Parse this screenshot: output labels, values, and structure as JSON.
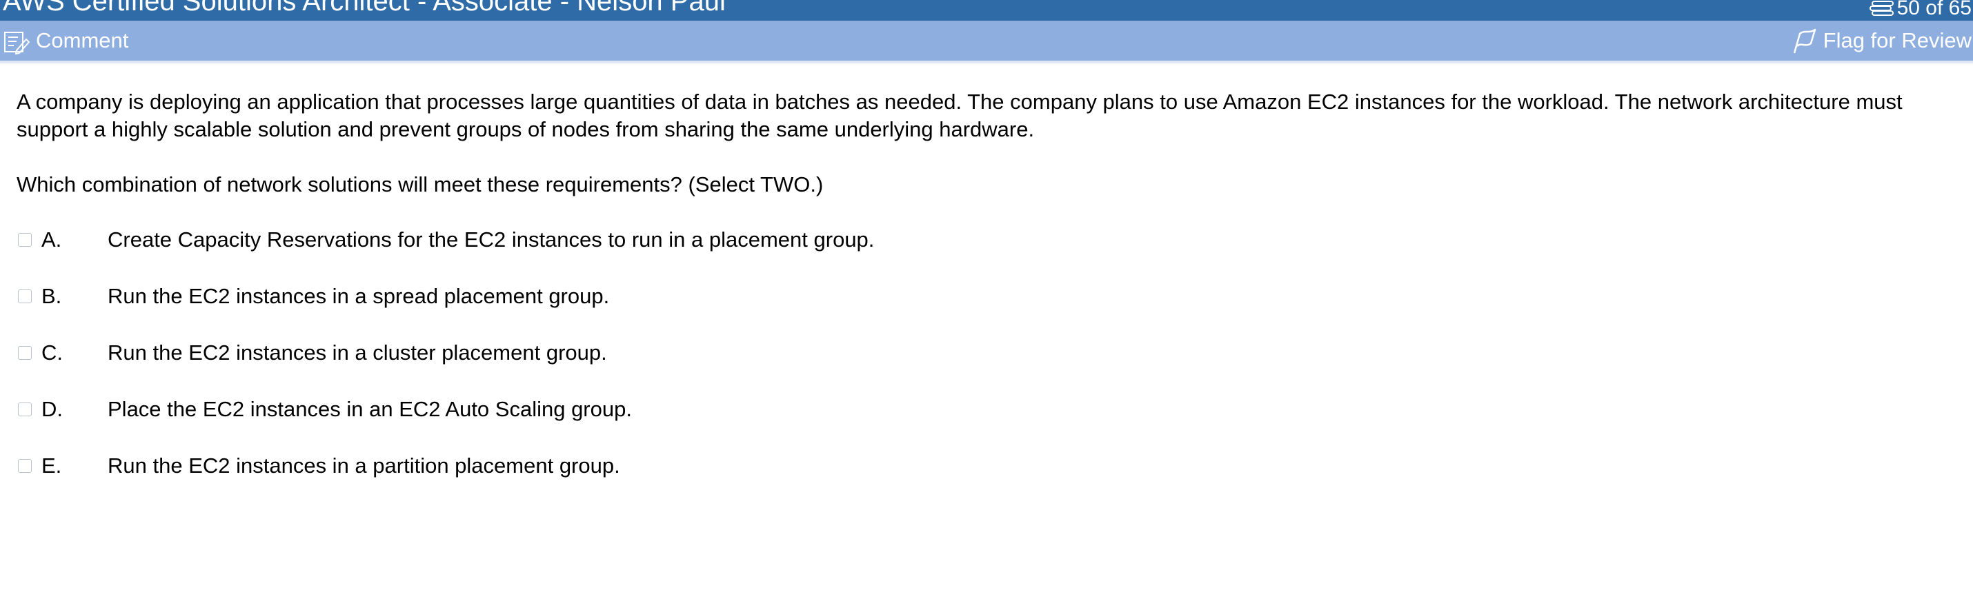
{
  "window": {
    "title": "AWS Certified Solutions Architect - Associate - Nelson Paul"
  },
  "header": {
    "counter_text": "50 of 65",
    "counter_icon": "stack-icon"
  },
  "toolbar": {
    "comment_label": "Comment",
    "comment_icon": "comment-edit-icon",
    "flag_label": "Flag for Review",
    "flag_icon": "flag-icon"
  },
  "question": {
    "text": "A company is deploying an application that processes large quantities of data in batches as needed. The company plans to use Amazon EC2 instances for the workload. The network architecture must support a highly scalable solution and prevent groups of nodes from sharing the same underlying hardware.",
    "prompt": "Which combination of network solutions will meet these requirements? (Select TWO.)",
    "options": [
      {
        "letter": "A.",
        "text": "Create Capacity Reservations for the EC2 instances to run in a placement group.",
        "checked": false
      },
      {
        "letter": "B.",
        "text": "Run the EC2 instances in a spread placement group.",
        "checked": false
      },
      {
        "letter": "C.",
        "text": "Run the EC2 instances in a cluster placement group.",
        "checked": false
      },
      {
        "letter": "D.",
        "text": "Place the EC2 instances in an EC2 Auto Scaling group.",
        "checked": false
      },
      {
        "letter": "E.",
        "text": "Run the EC2 instances in a partition placement group.",
        "checked": false
      }
    ]
  },
  "colors": {
    "title_bar": "#2f6ba6",
    "toolbar": "#8eaee0",
    "text": "#000000"
  }
}
